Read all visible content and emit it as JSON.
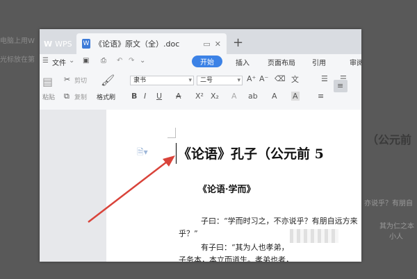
{
  "background": {
    "left_text_1": "电脑上用W",
    "left_text_2": "光标放在第",
    "right_title": "（公元前",
    "right_text_1": "亦说乎？有朋自",
    "right_text_2": "其为仁之本",
    "right_text_3": "小人"
  },
  "tabs": {
    "wps_label": "WPS",
    "doc_label": "《论语》原文（全）.doc",
    "doc_icon": "W",
    "new_tab": "+"
  },
  "menu": {
    "file": "文件",
    "start": "开始",
    "insert": "插入",
    "layout": "页面布局",
    "reference": "引用",
    "review": "审阅"
  },
  "ribbon": {
    "cut": "剪切",
    "copy": "复制",
    "paste": "粘贴",
    "format_painter": "格式刷",
    "font_name": "隶书",
    "font_size": "二号"
  },
  "document": {
    "title": "《论语》孔子（公元前 5",
    "subtitle": "《论语·学而》",
    "line1": "子曰：“学而时习之，不亦说乎？有朋自远方来",
    "line2": "乎？”",
    "line3": "有子曰：“其为人也孝弟，",
    "line4": "子务本，本立而道生。孝弟也者，"
  },
  "colors": {
    "accent": "#3c82e6",
    "annotation_arrow": "#d9433a"
  }
}
